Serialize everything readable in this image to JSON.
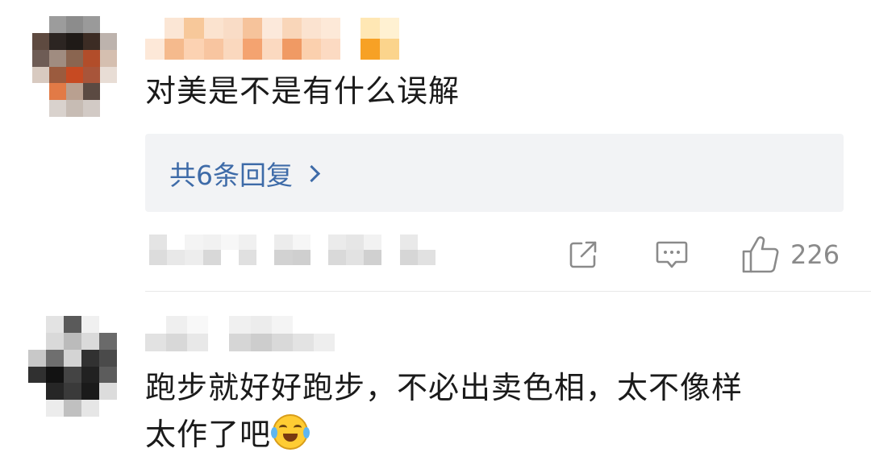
{
  "comments": [
    {
      "text": "对美是不是有什么误解",
      "reply_link": "共6条回复",
      "like_count": "226",
      "avatar_icon": "pixelated-avatar",
      "actions": [
        "share-icon",
        "comment-icon",
        "thumbs-up-icon"
      ]
    },
    {
      "text_line1": "跑步就好好跑步，不必出卖色相，太不像样",
      "text_line2": "太作了吧",
      "emoji_icon": "laughing-crying-emoji",
      "avatar_icon": "pixelated-avatar"
    }
  ],
  "colors": {
    "link": "#3e6ba8",
    "reply_bg": "#f2f3f5",
    "icon": "#8a8a8a",
    "text": "#1a1a1a"
  }
}
